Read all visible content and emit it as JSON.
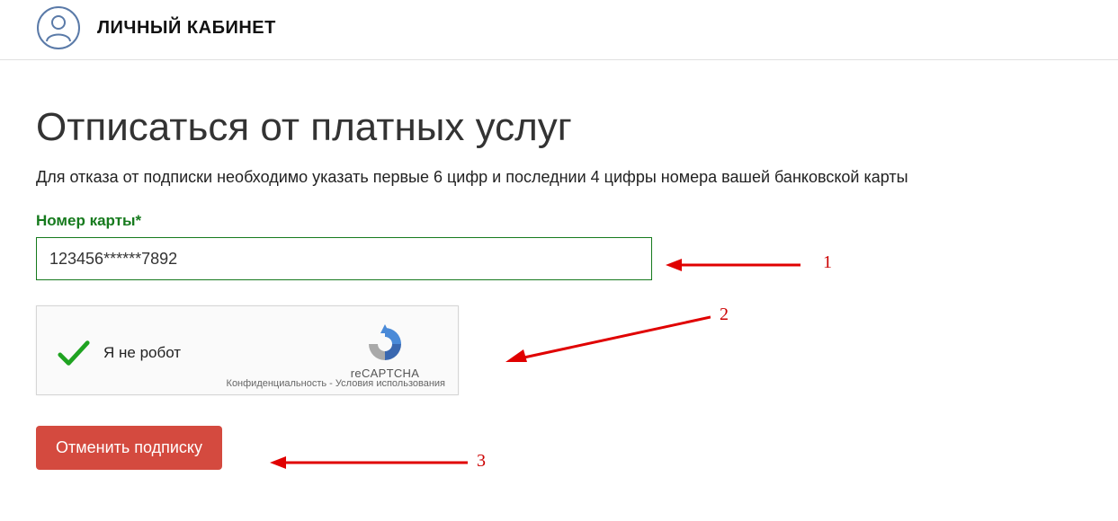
{
  "header": {
    "title": "ЛИЧНЫЙ КАБИНЕТ"
  },
  "page": {
    "title": "Отписаться от платных услуг",
    "description": "Для отказа от подписки необходимо указать первые 6 цифр и последнии 4 цифры номера вашей банковской карты"
  },
  "card": {
    "label": "Номер карты*",
    "value": "123456******7892"
  },
  "recaptcha": {
    "label": "Я не робот",
    "brand": "reCAPTCHA",
    "privacy": "Конфиденциальность",
    "terms": "Условия использования",
    "sep": " - "
  },
  "actions": {
    "cancel_subscription": "Отменить подписку"
  },
  "annotations": {
    "n1": "1",
    "n2": "2",
    "n3": "3"
  }
}
